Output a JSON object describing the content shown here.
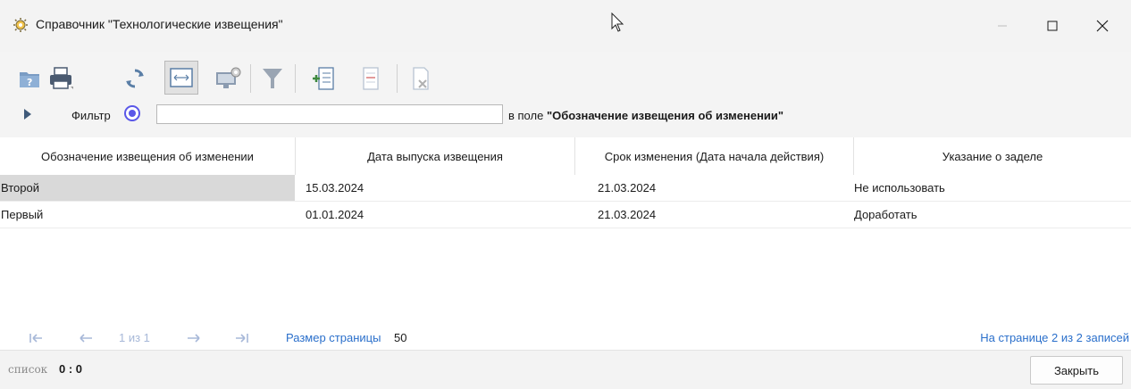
{
  "window": {
    "title": "Справочник \"Технологические извещения\"",
    "icon": "gear-icon"
  },
  "toolbar": {
    "items": [
      "help-icon",
      "print-icon",
      "refresh-icon",
      "fit-columns-icon",
      "monitor-settings-icon",
      "filter-icon",
      "add-record-icon",
      "edit-record-icon",
      "delete-record-icon"
    ],
    "active_item": "fit-columns-icon"
  },
  "filter": {
    "label": "Фильтр",
    "value": "",
    "field_prefix": "в поле ",
    "field_name": "\"Обозначение извещения об изменении\""
  },
  "grid": {
    "columns": [
      "Обозначение извещения об изменении",
      "Дата выпуска извещения",
      "Срок изменения (Дата начала действия)",
      "Указание о заделе"
    ],
    "rows": [
      {
        "designation": "Второй",
        "issue_date": "15.03.2024",
        "change_date": "21.03.2024",
        "backlog": "Не использовать"
      },
      {
        "designation": "Первый",
        "issue_date": "01.01.2024",
        "change_date": "21.03.2024",
        "backlog": "Доработать"
      }
    ],
    "selected_row": 0
  },
  "pager": {
    "page_info": "1 из 1",
    "page_size_label": "Размер страницы",
    "page_size": "50",
    "records_info": "На странице 2 из 2 записей"
  },
  "status": {
    "mode_label": "список",
    "counter": "0 : 0"
  },
  "buttons": {
    "close": "Закрыть"
  },
  "colors": {
    "accent": "#5a57e8",
    "link": "#2a6fcb",
    "selection": "#d9d9d9"
  }
}
